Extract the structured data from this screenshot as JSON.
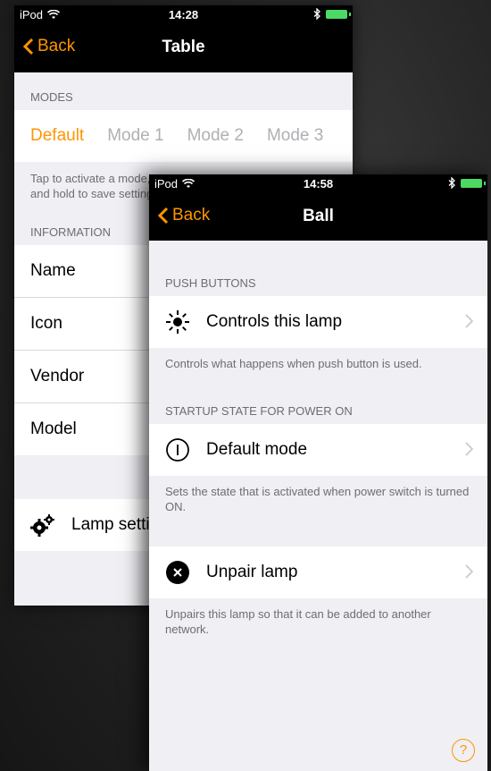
{
  "colors": {
    "accent": "#ff9500",
    "header_text": "#6d6d72",
    "navbar": "#000000",
    "background": "#efeff4"
  },
  "back_screen": {
    "status": {
      "carrier": "iPod",
      "time": "14:28"
    },
    "nav": {
      "back_label": "Back",
      "title": "Table"
    },
    "modes_header": "MODES",
    "modes": [
      "Default",
      "Mode 1",
      "Mode 2",
      "Mode 3"
    ],
    "active_mode": "Default",
    "modes_footer": "Tap to activate a mode, press and hold to save settings",
    "information_header": "INFORMATION",
    "info_rows": [
      "Name",
      "Icon",
      "Vendor",
      "Model"
    ],
    "lamp_settings_label": "Lamp settings",
    "lamp_settings_icon": "gears-icon"
  },
  "front_screen": {
    "status": {
      "carrier": "iPod",
      "time": "14:58"
    },
    "nav": {
      "back_label": "Back",
      "title": "Ball"
    },
    "push_buttons_header": "PUSH BUTTONS",
    "controls_label": "Controls this lamp",
    "controls_icon": "sun-icon",
    "controls_footer": "Controls what happens when push button is used.",
    "startup_header": "STARTUP STATE FOR POWER ON",
    "default_mode_label": "Default mode",
    "default_mode_icon": "power-icon",
    "default_mode_footer": "Sets the state that is activated when power switch is turned ON.",
    "unpair_label": "Unpair lamp",
    "unpair_icon": "x-circle-icon",
    "unpair_footer": "Unpairs this lamp so that it can be added to another network.",
    "help_label": "?"
  }
}
